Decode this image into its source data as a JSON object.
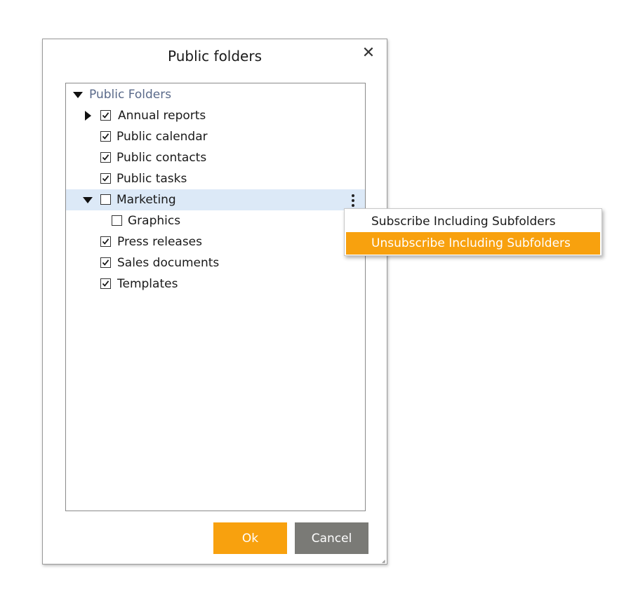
{
  "dialog": {
    "title": "Public folders",
    "close_icon": "close-icon"
  },
  "tree": {
    "root": {
      "label": "Public Folders",
      "expanded": true
    },
    "items": [
      {
        "label": "Annual reports",
        "checked": true,
        "expandable": true,
        "expanded": false
      },
      {
        "label": "Public calendar",
        "checked": true
      },
      {
        "label": "Public contacts",
        "checked": true
      },
      {
        "label": "Public tasks",
        "checked": true
      },
      {
        "label": "Marketing",
        "checked": false,
        "expandable": true,
        "expanded": true,
        "selected": true
      },
      {
        "label": "Graphics",
        "checked": false,
        "child_of": "Marketing"
      },
      {
        "label": "Press releases",
        "checked": true
      },
      {
        "label": "Sales documents",
        "checked": true
      },
      {
        "label": "Templates",
        "checked": true
      }
    ]
  },
  "context_menu": {
    "items": [
      {
        "label": "Subscribe Including Subfolders",
        "highlighted": false
      },
      {
        "label": "Unsubscribe Including Subfolders",
        "highlighted": true
      }
    ]
  },
  "buttons": {
    "ok_label": "Ok",
    "cancel_label": "Cancel"
  },
  "colors": {
    "accent": "#f8a10e",
    "cancel": "#7a7a76",
    "selection": "#dce9f7",
    "root_label": "#5a6a8a"
  }
}
